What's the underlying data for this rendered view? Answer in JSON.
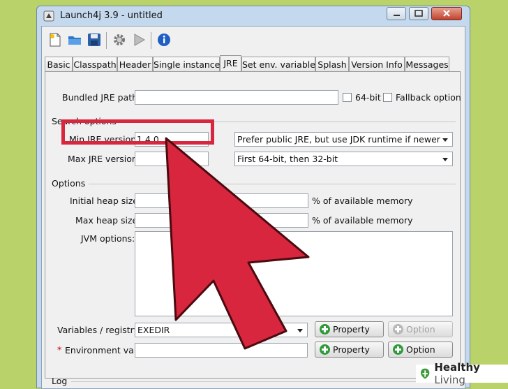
{
  "window": {
    "title": "Launch4j 3.9 - untitled"
  },
  "toolbar": {
    "buttons": [
      "new-icon",
      "open-folder-icon",
      "save-icon",
      "settings-gear-icon",
      "play-icon",
      "info-icon"
    ]
  },
  "tabs": [
    {
      "label": "Basic"
    },
    {
      "label": "Classpath"
    },
    {
      "label": "Header"
    },
    {
      "label": "Single instance"
    },
    {
      "label": "JRE",
      "active": true
    },
    {
      "label": "Set env. variables"
    },
    {
      "label": "Splash"
    },
    {
      "label": "Version Info"
    },
    {
      "label": "Messages"
    }
  ],
  "jre": {
    "bundled_label": "Bundled JRE path:",
    "bundled_value": "",
    "bit64_label": "64-bit",
    "fallback_label": "Fallback option",
    "search_heading": "Search options",
    "min_label": "Min JRE version:",
    "min_value": "1.4.0",
    "min_combo": "Prefer public JRE, but use JDK runtime if newer",
    "max_label": "Max JRE version:",
    "max_value": "",
    "max_combo": "First 64-bit, then 32-bit",
    "options_heading": "Options",
    "initial_heap_label": "Initial heap size:",
    "max_heap_label": "Max heap size:",
    "percent_label": "% of available memory",
    "jvm_label": "JVM options:",
    "variables_label": "Variables / registry:",
    "variables_value": "EXEDIR",
    "property_label": "Property",
    "option_label": "Option",
    "required_mark": "*",
    "env_label": "Environment var:",
    "log_heading": "Log"
  },
  "colors": {
    "highlight": "#d7263d",
    "arrow": "#d7263d",
    "plus_green": "#2f9a3a"
  },
  "watermark": {
    "brand": "Healthy",
    "suffix": "Living"
  }
}
